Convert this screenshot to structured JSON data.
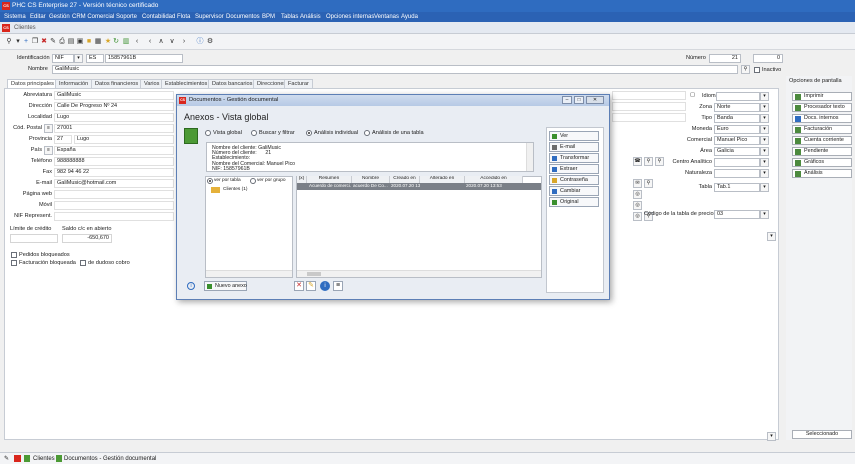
{
  "app": {
    "title": "PHC CS Enterprise 27 - Versión técnico certificado",
    "logo": "CS",
    "menu": [
      "Sistema",
      "Editar",
      "Gestión",
      "CRM Comercial",
      "Soporte",
      "Contabilidad",
      "Flota",
      "Supervisor",
      "Documentos",
      "BPM",
      "Tablas",
      "Análisis",
      "Opciones internas",
      "Ventanas",
      "Ayuda"
    ]
  },
  "window": {
    "title": "Clientes"
  },
  "header": {
    "identificacion_label": "Identificación",
    "id_type": "NIF",
    "country_code": "ES",
    "nif": "15857961B",
    "nombre_label": "Nombre",
    "nombre": "GaliMusic",
    "numero_label": "Número",
    "numero": "21",
    "numero2": "0",
    "inactivo_label": "Inactivo"
  },
  "tabs": [
    "Datos principales",
    "Información",
    "Datos financieros",
    "Varios",
    "Establecimientos",
    "Datos bancarios",
    "Direcciones",
    "Facturar"
  ],
  "left_fields": [
    {
      "label": "Abreviatura",
      "value": "GaliMusic"
    },
    {
      "label": "Dirección",
      "value": "Calle De Progreso Nº 24"
    },
    {
      "label": "Localidad",
      "value": "Lugo"
    },
    {
      "label": "Cód. Postal",
      "value": "27001"
    },
    {
      "label": "Provincia",
      "value": "27",
      "extra": "Lugo"
    },
    {
      "label": "País",
      "value": "España"
    },
    {
      "label": "Teléfono",
      "value": "988888888"
    },
    {
      "label": "Fax",
      "value": "982 94 46 22"
    },
    {
      "label": "E-mail",
      "value": "GaliMusic@hotmail.com"
    },
    {
      "label": "Página web",
      "value": ""
    },
    {
      "label": "Móvil",
      "value": ""
    },
    {
      "label": "NIF Represent.",
      "value": ""
    }
  ],
  "credit": {
    "limite_label": "Límite de crédito",
    "saldo_label": "Saldo c/c en abierto",
    "saldo": "-650,670"
  },
  "checkboxes": [
    "Pedidos bloqueados",
    "Facturación bloqueada",
    "de dudoso cobro"
  ],
  "right_fields": [
    {
      "label": "Idioma",
      "value": ""
    },
    {
      "label": "Zona",
      "value": "Norte"
    },
    {
      "label": "Tipo",
      "value": "Banda"
    },
    {
      "label": "Moneda",
      "value": "Euro"
    },
    {
      "label": "Comercial",
      "value": "Manuel Pico"
    },
    {
      "label": "Área",
      "value": "Galicia"
    },
    {
      "label": "Centro Analítico",
      "value": ""
    },
    {
      "label": "Naturaleza",
      "value": ""
    },
    {
      "label": "Tabla",
      "value": "Tab.1"
    },
    {
      "label": "Código de la tabla de precios",
      "value": "03"
    }
  ],
  "right_panel": {
    "title": "Opciones de pantalla",
    "buttons": [
      "Imprimir",
      "Procesador texto",
      "Docs. internos",
      "Facturación",
      "Cuenta corriente",
      "Pendiente",
      "Gráficos",
      "Análisis"
    ],
    "selected": "Seleccionado"
  },
  "dialog": {
    "title": "Documentos - Gestión documental",
    "heading": "Anexos - Vista global",
    "radios": [
      "Vista global",
      "Buscar y filtrar",
      "Análisis individual",
      "Análisis de una tabla"
    ],
    "info_lines": [
      {
        "label": "Nombre del cliente:",
        "value": "GaliMusic"
      },
      {
        "label": "Número del cliente:",
        "value": "21"
      },
      {
        "label": "Establecimiento:",
        "value": ""
      },
      {
        "label": "Nombre del Comercial:",
        "value": "Manuel Pico"
      },
      {
        "label": "NIF:",
        "value": "15857961B"
      }
    ],
    "view_options": [
      "ver por tabla",
      "ver por grupo"
    ],
    "tree_item": "Clientes (1)",
    "columns": [
      "(x)",
      "Resumen",
      "Nombre",
      "Creado en",
      "Alterado en",
      "Accedido en"
    ],
    "row": [
      "Acuerdo de comerci...",
      "acuerdo De Co...",
      "2020.07.20 13:53",
      "2020.07.20 13:53"
    ],
    "buttons": [
      "Ver",
      "E-mail",
      "Transformar",
      "Extraer",
      "Contraseña",
      "Cambiar",
      "Original"
    ],
    "new_button": "Nuevo anexo"
  },
  "status": {
    "items": [
      "Clientes",
      "Documentos - Gestión documental"
    ]
  },
  "colors": {
    "titlebar": "#2f6cc0",
    "menubar": "#2b62b4",
    "selection": "#7a7f87",
    "logo": "#d9261c"
  }
}
